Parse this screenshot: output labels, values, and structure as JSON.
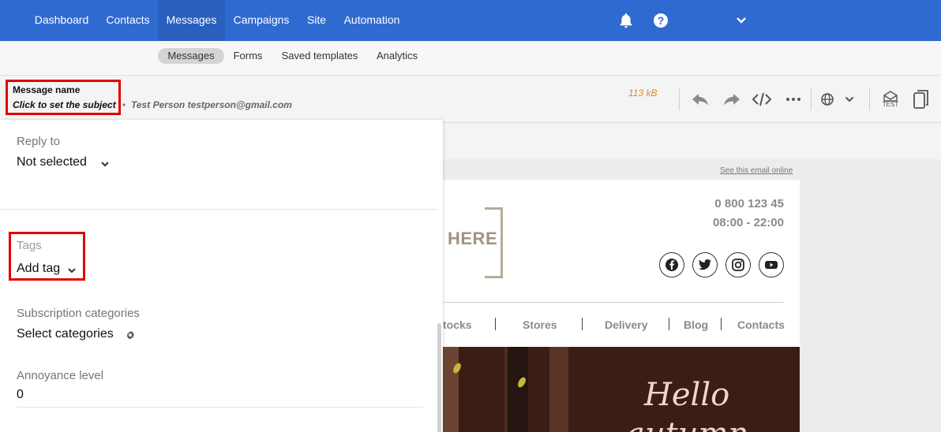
{
  "nav": {
    "items": [
      {
        "label": "Dashboard",
        "active": false
      },
      {
        "label": "Contacts",
        "active": false
      },
      {
        "label": "Messages",
        "active": true
      },
      {
        "label": "Campaigns",
        "active": false
      },
      {
        "label": "Site",
        "active": false
      },
      {
        "label": "Automation",
        "active": false
      }
    ],
    "icons": [
      "bell-icon",
      "help-icon",
      "chevron-down-icon"
    ]
  },
  "subnav": {
    "items": [
      {
        "label": "Messages",
        "active": true
      },
      {
        "label": "Forms",
        "active": false
      },
      {
        "label": "Saved templates",
        "active": false
      },
      {
        "label": "Analytics",
        "active": false
      }
    ]
  },
  "message": {
    "name": "Message name",
    "subject_placeholder": "Click to set the subject",
    "separator": "•",
    "from": "Test Person testperson@gmail.com",
    "size": "113 kB",
    "test_label": "TEST"
  },
  "preview": {
    "see_online": "See this email online",
    "logo_text": "HERE",
    "phone": "0 800 123 45",
    "hours": "08:00 - 22:00",
    "social": [
      "facebook-icon",
      "twitter-icon",
      "instagram-icon",
      "youtube-icon"
    ],
    "nav": [
      "tocks",
      "Stores",
      "Delivery",
      "Blog",
      "Contacts"
    ],
    "nav_separator": "|",
    "hero_line1": "Hello",
    "hero_line2": "autumn"
  },
  "panel": {
    "reply_to": {
      "label": "Reply to",
      "value": "Not selected"
    },
    "tags": {
      "label": "Tags",
      "value": "Add tag"
    },
    "subscription": {
      "label": "Subscription categories",
      "value": "Select categories"
    },
    "annoyance": {
      "label": "Annoyance level",
      "value": "0"
    }
  },
  "colors": {
    "nav_bg": "#2f6ad0",
    "highlight": "#e00000",
    "size_text": "#d98a2b",
    "hero_bg": "#3a1d14"
  }
}
